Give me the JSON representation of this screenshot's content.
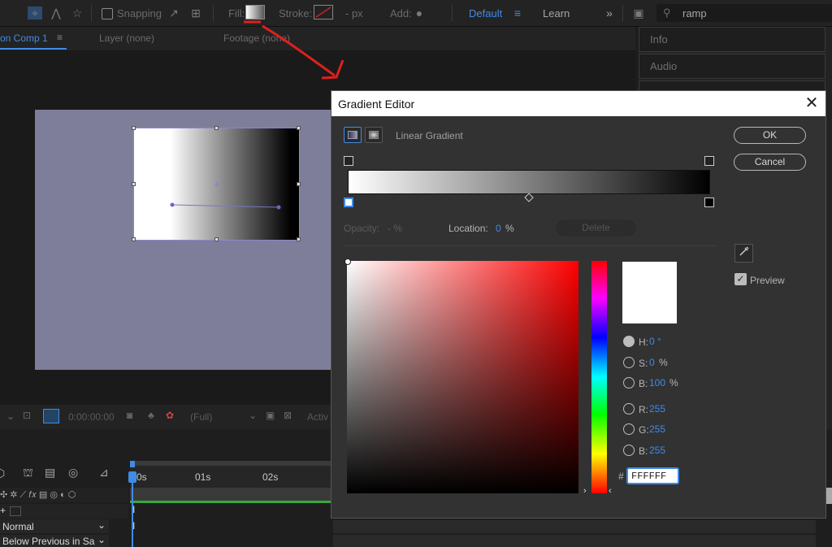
{
  "toolbar": {
    "snapping_label": "Snapping",
    "fill_label": "Fill:",
    "stroke_label": "Stroke:",
    "px_label": "- px",
    "add_label": "Add:",
    "workspace_default": "Default",
    "workspace_learn": "Learn",
    "search_value": "ramp"
  },
  "comp_panel": {
    "comp_tab": "on Comp 1",
    "layer_tab": "Layer (none)",
    "footage_tab": "Footage (none)",
    "timecode": "0:00:00:00",
    "resolution": "(Full)",
    "active_label": "Activ"
  },
  "right_panel": {
    "items": [
      "Info",
      "Audio"
    ]
  },
  "timeline": {
    "ticks": [
      "0s",
      "01s",
      "02s"
    ],
    "blend_mode": "Normal",
    "track_matte": "Below Previous in Sa"
  },
  "gradient_editor": {
    "title": "Gradient Editor",
    "type_label": "Linear Gradient",
    "ok_label": "OK",
    "cancel_label": "Cancel",
    "opacity_label": "Opacity:",
    "opacity_value": "- %",
    "location_label": "Location:",
    "location_value": "0",
    "location_unit": "%",
    "delete_label": "Delete",
    "preview_label": "Preview",
    "h_label": "H:",
    "h_value": "0 °",
    "s_label": "S:",
    "s_value": "0",
    "s_unit": "%",
    "b_label": "B:",
    "b_value": "100",
    "b_unit": "%",
    "r_label": "R:",
    "r_value": "255",
    "g_label": "G:",
    "g_value": "255",
    "bb_label": "B:",
    "bb_value": "255",
    "hex_prefix": "#",
    "hex_value": "FFFFFF"
  },
  "colors": {
    "accent": "#3f8be6",
    "annotation": "#e0201c",
    "canvas": "#7e7e9a",
    "timeline_green": "#3aa83a"
  },
  "icons": [
    "close-icon",
    "eyedropper-icon",
    "search-icon",
    "checkmark-icon",
    "chevron-down-icon"
  ]
}
